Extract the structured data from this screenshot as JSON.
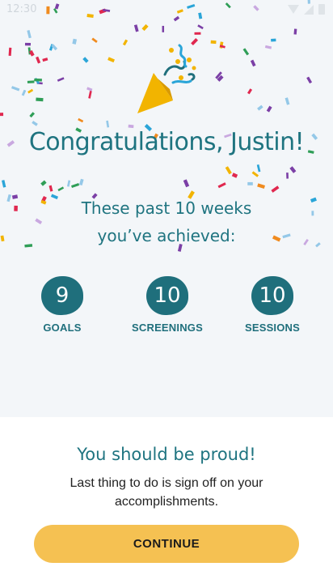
{
  "status_bar": {
    "time": "12:30"
  },
  "celebration": {
    "title": "Congratulations, Justin!",
    "subtitle": "These past 10 weeks you’ve achieved:"
  },
  "stats": [
    {
      "value": "9",
      "label": "GOALS"
    },
    {
      "value": "10",
      "label": "SCREENINGS"
    },
    {
      "value": "10",
      "label": "SESSIONS"
    }
  ],
  "footer": {
    "heading": "You should be proud!",
    "description": "Last thing to do is sign off on your accomplishments.",
    "continue_label": "CONTINUE"
  },
  "colors": {
    "accent": "#1f7480",
    "button": "#f5c152",
    "background": "#f3f6f9",
    "confetti": [
      "#e0284f",
      "#f2b400",
      "#2aa5d8",
      "#7b3fa6",
      "#2f9e57",
      "#f08b1f",
      "#94c8e8",
      "#c9a8e0"
    ]
  },
  "icons": {
    "party": "party-popper-icon"
  }
}
